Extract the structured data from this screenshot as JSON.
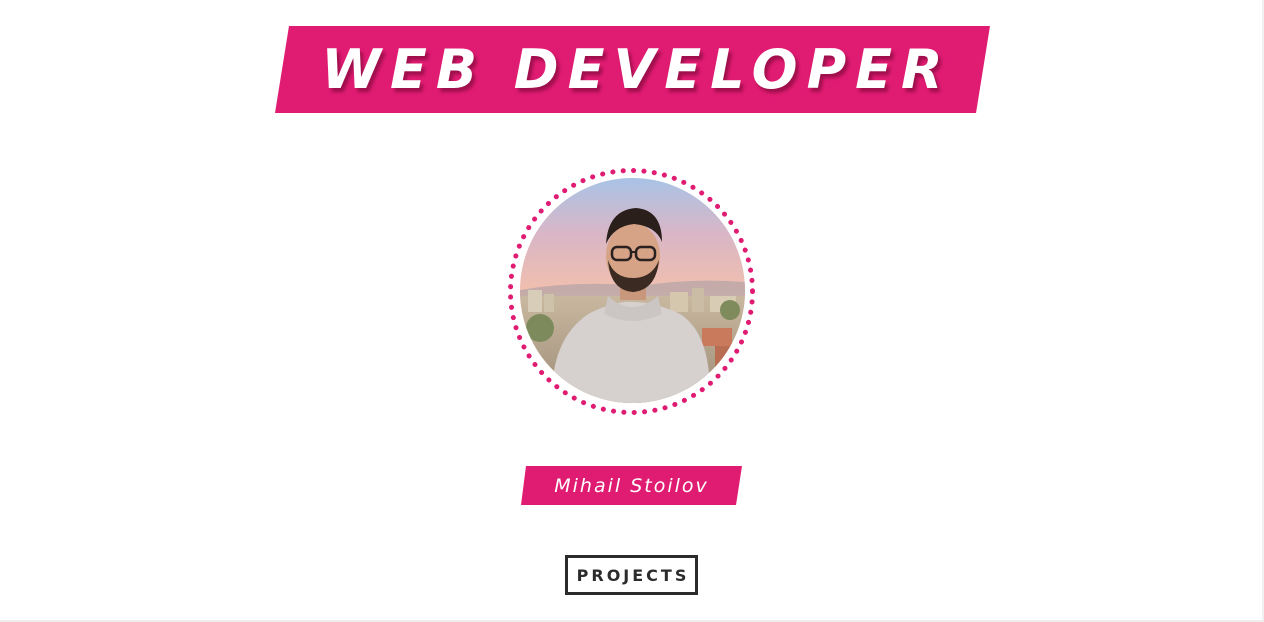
{
  "header": {
    "title": "WEB DEVELOPER"
  },
  "profile": {
    "name": "Mihail Stoilov",
    "photo_icon": "profile-photo"
  },
  "nav": {
    "projects_label": "PROJECTS"
  },
  "colors": {
    "accent": "#e01b72",
    "button_border": "#2b2b2b",
    "background": "#ffffff"
  }
}
